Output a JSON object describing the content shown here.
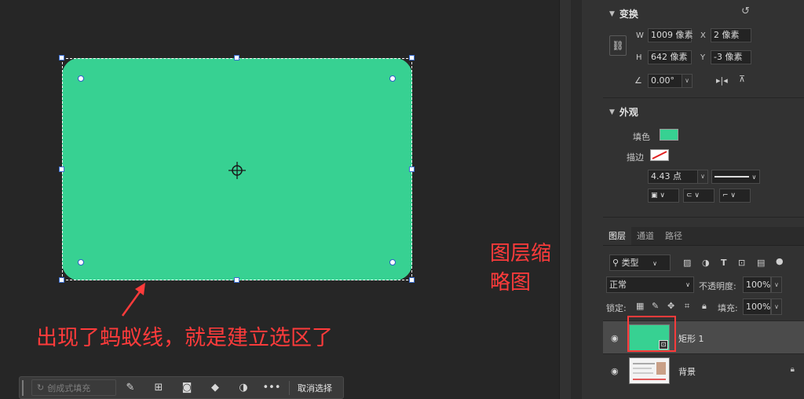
{
  "annotations": {
    "selection_note": "出现了蚂蚁线，就是建立选区了",
    "thumbnail_note": "图层缩略图"
  },
  "taskbar": {
    "generative_fill_placeholder": "创成式填充",
    "more_label": "•••",
    "deselect_label": "取消选择"
  },
  "properties": {
    "transform": {
      "title": "变换",
      "w_label": "W",
      "w_value": "1009 像素",
      "h_label": "H",
      "h_value": "642 像素",
      "x_label": "X",
      "x_value": "2 像素",
      "y_label": "Y",
      "y_value": "-3 像素",
      "angle_value": "0.00°"
    },
    "appearance": {
      "title": "外观",
      "fill_label": "填色",
      "fill_color": "#37d192",
      "stroke_label": "描边",
      "stroke_width": "4.43 点"
    }
  },
  "layers": {
    "tabs": [
      "图层",
      "通道",
      "路径"
    ],
    "filter_label": "类型",
    "blend_mode": "正常",
    "opacity_label": "不透明度:",
    "opacity_value": "100%",
    "lock_label": "锁定:",
    "fill_label": "填充:",
    "fill_value": "100%",
    "items": [
      {
        "name": "矩形 1",
        "selected": true
      },
      {
        "name": "背景",
        "selected": false
      }
    ]
  },
  "colors": {
    "accent_annotation": "#ff3b3b",
    "shape_fill": "#37d192",
    "selection_handle": "#3b6fd4"
  }
}
